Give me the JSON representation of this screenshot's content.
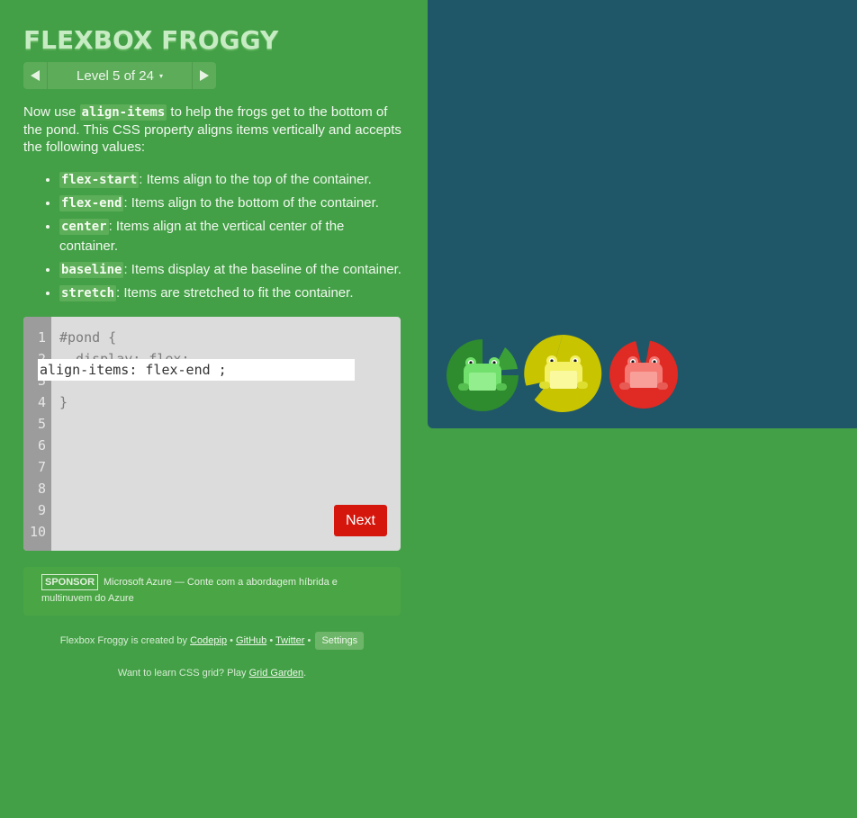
{
  "app": {
    "title": "FLEXBOX FROGGY"
  },
  "level_nav": {
    "prev_icon": "triangle-left",
    "next_icon": "triangle-right",
    "label": "Level 5 of 24",
    "caret": "▾"
  },
  "instructions": {
    "intro_before": "Now use ",
    "intro_code": "align-items",
    "intro_after": " to help the frogs get to the bottom of the pond. This CSS property aligns items vertically and accepts the following values:",
    "values": [
      {
        "code": "flex-start",
        "text": ": Items align to the top of the container."
      },
      {
        "code": "flex-end",
        "text": ": Items align to the bottom of the container."
      },
      {
        "code": "center",
        "text": ": Items align at the vertical center of the container."
      },
      {
        "code": "baseline",
        "text": ": Items display at the baseline of the container."
      },
      {
        "code": "stretch",
        "text": ": Items are stretched to fit the container."
      }
    ]
  },
  "editor": {
    "line_numbers": [
      "1",
      "2",
      "3",
      "4",
      "5",
      "6",
      "7",
      "8",
      "9",
      "10"
    ],
    "line1": "#pond {",
    "line2": "  display: flex;",
    "input_value": "align-items: flex-end ;",
    "line4": "}",
    "next_label": "Next"
  },
  "sponsor": {
    "tag": "SPONSOR",
    "text": "Microsoft Azure — Conte com a abordagem híbrida e multinuvem do Azure"
  },
  "footer": {
    "created_by": "Flexbox Froggy is created by ",
    "codepip": "Codepip",
    "sep": " • ",
    "github": "GitHub",
    "twitter": "Twitter",
    "settings": "Settings",
    "grid_prefix": "Want to learn CSS grid? Play ",
    "grid_link": "Grid Garden",
    "grid_suffix": "."
  },
  "pond": {
    "background_color": "#1f5768",
    "frogs": [
      {
        "color": "green",
        "pad": "#2e8b2e",
        "body": "#72e06c"
      },
      {
        "color": "yellow",
        "pad": "#c9c400",
        "body": "#f4f166"
      },
      {
        "color": "red",
        "pad": "#e02a24",
        "body": "#f57a74"
      }
    ]
  }
}
